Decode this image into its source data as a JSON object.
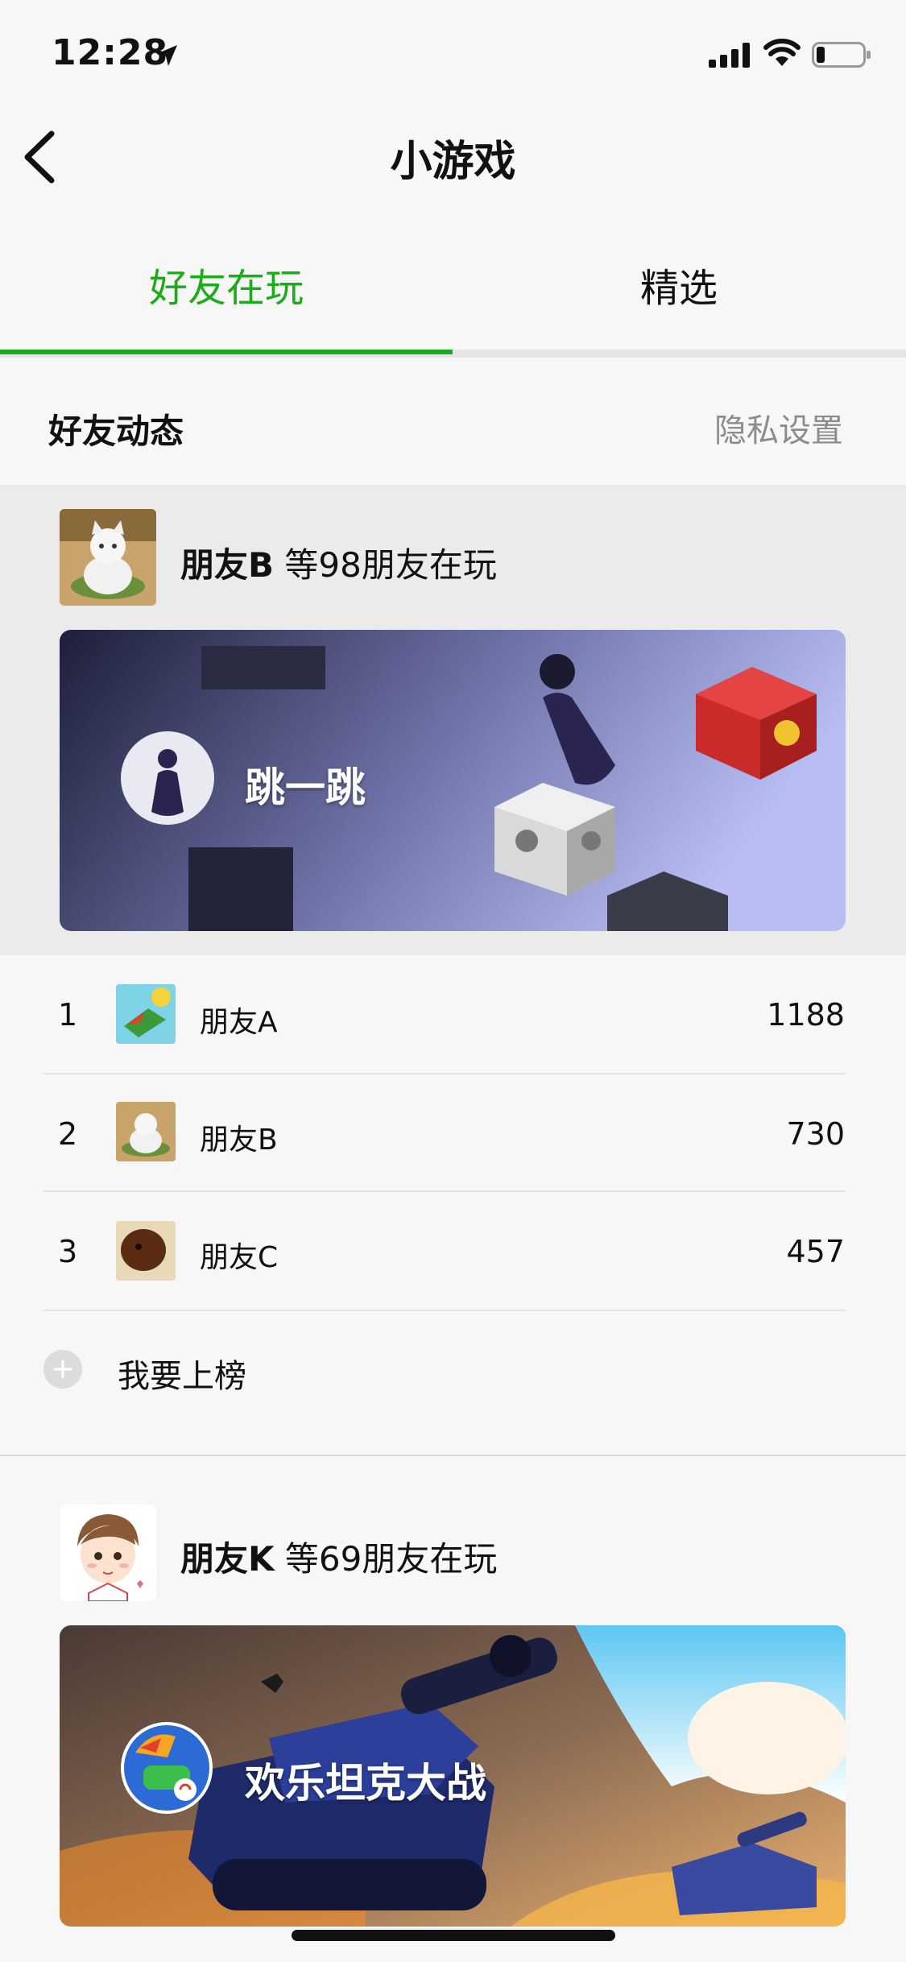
{
  "status": {
    "time": "12:28"
  },
  "nav": {
    "title": "小游戏"
  },
  "tabs": [
    {
      "label": "好友在玩",
      "active": true
    },
    {
      "label": "精选",
      "active": false
    }
  ],
  "section": {
    "title": "好友动态",
    "privacy_label": "隐私设置"
  },
  "feed": [
    {
      "friend_name": "朋友B",
      "friend_suffix": "等98朋友在玩",
      "game_name": "跳一跳",
      "leaderboard": [
        {
          "rank": "1",
          "name": "朋友A",
          "score": "1188"
        },
        {
          "rank": "2",
          "name": "朋友B",
          "score": "730"
        },
        {
          "rank": "3",
          "name": "朋友C",
          "score": "457"
        }
      ],
      "join_label": "我要上榜"
    },
    {
      "friend_name": "朋友K",
      "friend_suffix": "等69朋友在玩",
      "game_name": "欢乐坦克大战"
    }
  ],
  "colors": {
    "accent": "#1aad19",
    "muted": "#8c8c8c"
  },
  "icons": {
    "back": "chevron-left-icon",
    "location": "location-arrow-icon",
    "signal": "cellular-signal-icon",
    "wifi": "wifi-icon",
    "battery": "battery-icon",
    "add": "plus-circle-icon"
  }
}
